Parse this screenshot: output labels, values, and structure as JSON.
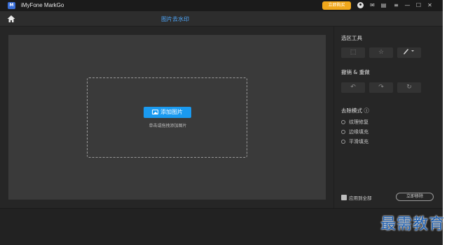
{
  "window": {
    "app_title": "iMyFone MarkGo",
    "logo_text": "M",
    "buy_label": "立即购买"
  },
  "header": {
    "title": "图片去水印"
  },
  "canvas": {
    "add_button_label": "添加图片",
    "drop_hint": "单击或拖拽添加图片"
  },
  "panel": {
    "selection_tools_title": "选区工具",
    "undo_redo_title": "撤销 & 重做",
    "removal_mode_title": "去除模式 ⓘ",
    "modes": [
      "纹理修复",
      "边缘填充",
      "平滑填充"
    ],
    "apply_all_label": "应用到全部",
    "remove_now_label": "立即移除"
  },
  "icons": {
    "rect_select": "⬚",
    "star_select": "☆",
    "brush_select": "🖌",
    "undo": "↶",
    "redo": "↷",
    "reset": "↻",
    "min": "—",
    "max": "☐",
    "close": "✕",
    "menu": "≡",
    "mail": "✉",
    "msg": "▤"
  },
  "watermark": {
    "text": "最需教育"
  },
  "colors": {
    "accent": "#1a9af0",
    "title_blue": "#4fa9ff",
    "buy": "#f0a71b"
  }
}
